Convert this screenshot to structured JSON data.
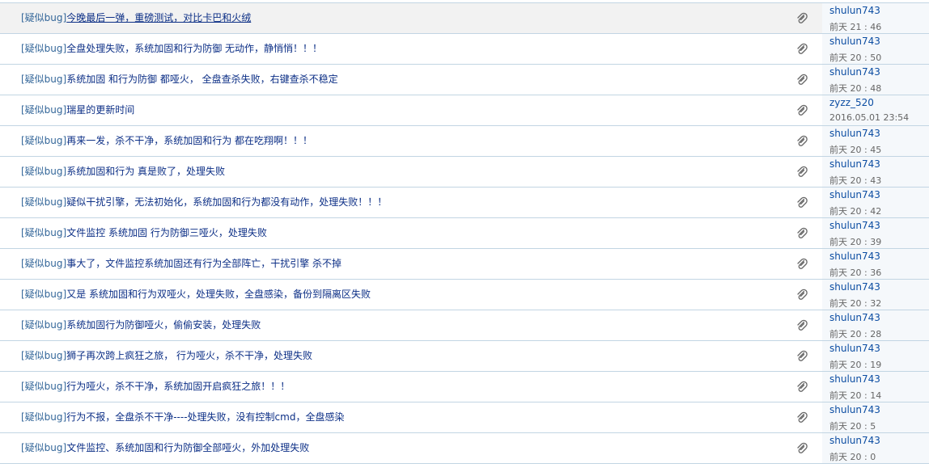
{
  "icons": {
    "attachment": "paperclip-icon"
  },
  "colors": {
    "link": "#0c2f86",
    "tag": "#336699",
    "author": "#0c4da2",
    "date": "#666666",
    "border": "#c2d5e3"
  },
  "threads": [
    {
      "tag": "[疑似bug]",
      "title": "今晚最后一弹，重磅测试，对比卡巴和火绒",
      "author": "shulun743",
      "date": "前天 21 : 46"
    },
    {
      "tag": "[疑似bug]",
      "title": "全盘处理失败，系统加固和行为防御 无动作，静悄悄！！！",
      "author": "shulun743",
      "date": "前天 20 : 50"
    },
    {
      "tag": "[疑似bug]",
      "title": "系统加固 和行为防御 都哑火， 全盘查杀失败，右键查杀不稳定",
      "author": "shulun743",
      "date": "前天 20 : 48"
    },
    {
      "tag": "[疑似bug]",
      "title": "瑞星的更新时间",
      "author": "zyzz_520",
      "date": "2016.05.01 23:54"
    },
    {
      "tag": "[疑似bug]",
      "title": "再来一发，杀不干净，系统加固和行为 都在吃翔啊！！！",
      "author": "shulun743",
      "date": "前天 20 : 45"
    },
    {
      "tag": "[疑似bug]",
      "title": "系统加固和行为 真是败了，处理失败",
      "author": "shulun743",
      "date": "前天 20 : 43"
    },
    {
      "tag": "[疑似bug]",
      "title": "疑似干扰引擎，无法初始化，系统加固和行为都没有动作，处理失败！！！",
      "author": "shulun743",
      "date": "前天 20 : 42"
    },
    {
      "tag": "[疑似bug]",
      "title": "文件监控 系统加固 行为防御三哑火，处理失败",
      "author": "shulun743",
      "date": "前天 20 : 39"
    },
    {
      "tag": "[疑似bug]",
      "title": "事大了，文件监控系统加固还有行为全部阵亡，干扰引擎 杀不掉",
      "author": "shulun743",
      "date": "前天 20 : 36"
    },
    {
      "tag": "[疑似bug]",
      "title": "又是 系统加固和行为双哑火，处理失败，全盘感染，备份到隔离区失败",
      "author": "shulun743",
      "date": "前天 20 : 32"
    },
    {
      "tag": "[疑似bug]",
      "title": "系统加固行为防御哑火，偷偷安装，处理失败",
      "author": "shulun743",
      "date": "前天 20 : 28"
    },
    {
      "tag": "[疑似bug]",
      "title": "狮子再次跨上疯狂之旅， 行为哑火，杀不干净，处理失败",
      "author": "shulun743",
      "date": "前天 20 : 19"
    },
    {
      "tag": "[疑似bug]",
      "title": "行为哑火，杀不干净，系统加固开启疯狂之旅！！！",
      "author": "shulun743",
      "date": "前天 20 : 14"
    },
    {
      "tag": "[疑似bug]",
      "title": "行为不报，全盘杀不干净----处理失败，没有控制cmd，全盘感染",
      "author": "shulun743",
      "date": "前天 20 : 5"
    },
    {
      "tag": "[疑似bug]",
      "title": "文件监控、系统加固和行为防御全部哑火，外加处理失败",
      "author": "shulun743",
      "date": "前天 20 : 0"
    }
  ]
}
